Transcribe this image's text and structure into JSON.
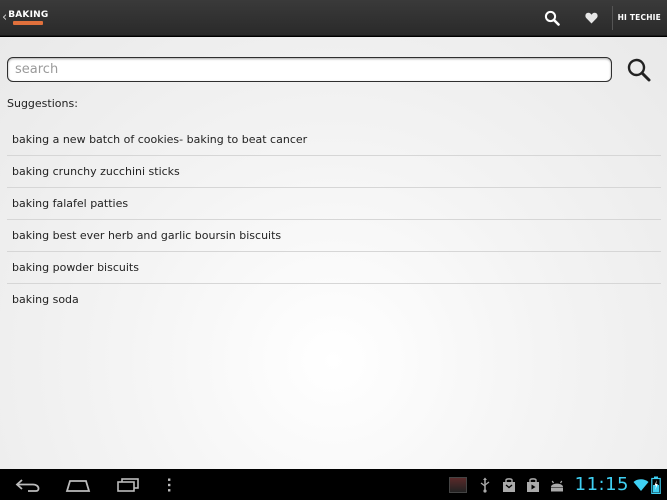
{
  "action_bar": {
    "logo_text": "BAKING",
    "user_label": "HI TECHIE",
    "icons": [
      "back-chevron-icon",
      "search-icon",
      "heart-icon"
    ]
  },
  "search": {
    "placeholder": "search",
    "value": ""
  },
  "suggestions": {
    "title": "Suggestions:",
    "items": [
      "baking a new batch of cookies- baking to beat cancer",
      "baking crunchy zucchini sticks",
      "baking falafel patties",
      "baking best ever herb and garlic boursin biscuits",
      "baking powder biscuits",
      "baking soda"
    ]
  },
  "system_bar": {
    "time": "11:15",
    "icons": [
      "back-icon",
      "home-icon",
      "recent-apps-icon",
      "menu-icon",
      "usb-icon",
      "bag-icon",
      "play-store-icon",
      "android-icon",
      "wifi-icon",
      "battery-icon"
    ]
  },
  "colors": {
    "action_bar": "#2f2f2f",
    "brand_accent": "#e0703c",
    "clock": "#3fd0f3"
  }
}
